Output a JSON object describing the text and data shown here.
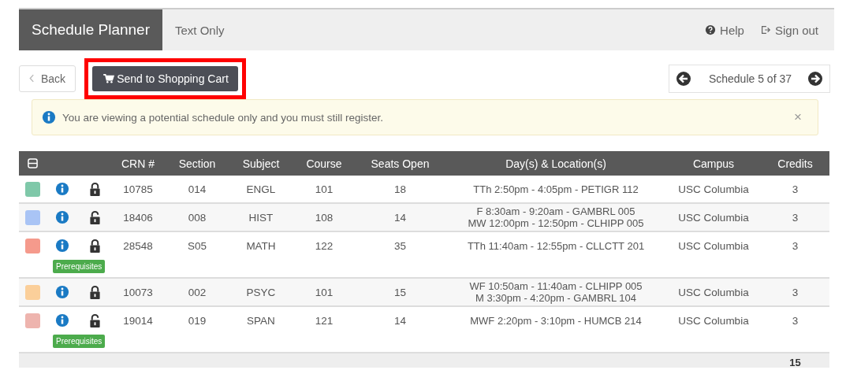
{
  "nav": {
    "title": "Schedule Planner",
    "link": "Text Only",
    "help": "Help",
    "sign_out": "Sign out"
  },
  "toolbar": {
    "back": "Back",
    "send": "Send to Shopping Cart",
    "send_highlighted": true,
    "schedule": "Schedule 5 of 37"
  },
  "alert": {
    "message": "You are viewing a potential schedule only and you must still register.",
    "close": "×"
  },
  "table": {
    "columns": [
      "CRN #",
      "Section",
      "Subject",
      "Course",
      "Seats Open",
      "Day(s) & Location(s)",
      "Campus",
      "Credits"
    ],
    "rows": [
      {
        "color": "#7fc8a9",
        "locked": true,
        "crn": "10785",
        "section": "014",
        "subject": "ENGL",
        "course": "101",
        "seats": "18",
        "times": [
          "TTh 2:50pm - 4:05pm - PETIGR 112"
        ],
        "campus": "USC Columbia",
        "credits": "3"
      },
      {
        "color": "#a9c4f5",
        "locked": false,
        "crn": "18406",
        "section": "008",
        "subject": "HIST",
        "course": "108",
        "seats": "14",
        "times": [
          "F 8:30am - 9:20am - GAMBRL 005",
          "MW 12:00pm - 12:50pm - CLHIPP 005"
        ],
        "campus": "USC Columbia",
        "credits": "3"
      },
      {
        "color": "#f59a8c",
        "locked": true,
        "crn": "28548",
        "section": "S05",
        "subject": "MATH",
        "course": "122",
        "seats": "35",
        "times": [
          "TTh 11:40am - 12:55pm - CLLCTT 201"
        ],
        "campus": "USC Columbia",
        "credits": "3",
        "badge": "Prerequisites"
      },
      {
        "color": "#fbcf9a",
        "locked": true,
        "crn": "10073",
        "section": "002",
        "subject": "PSYC",
        "course": "101",
        "seats": "15",
        "times": [
          "WF 10:50am - 11:40am - CLHIPP 005",
          "M 3:30pm - 4:20pm - GAMBRL 104"
        ],
        "campus": "USC Columbia",
        "credits": "3"
      },
      {
        "color": "#eeb4ae",
        "locked": false,
        "crn": "19014",
        "section": "019",
        "subject": "SPAN",
        "course": "121",
        "seats": "14",
        "times": [
          "MWF 2:20pm - 3:10pm - HUMCB 214"
        ],
        "campus": "USC Columbia",
        "credits": "3",
        "badge": "Prerequisites"
      }
    ],
    "total_credits": "15"
  }
}
